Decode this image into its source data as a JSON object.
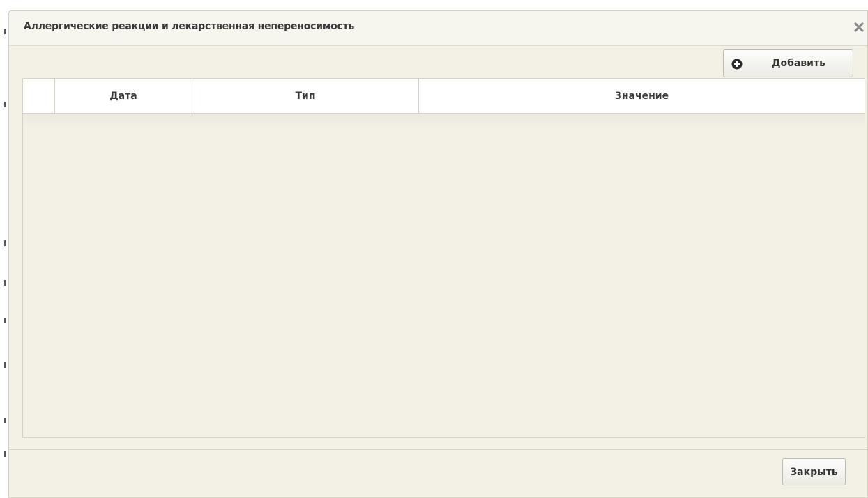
{
  "dialog": {
    "title": "Аллергические реакции и лекарственная непереносимость",
    "close_icon": "close-x-icon",
    "add_button": {
      "label": "Добавить",
      "icon": "plus-circle-icon"
    },
    "table": {
      "columns": [
        {
          "key": "select",
          "label": ""
        },
        {
          "key": "date",
          "label": "Дата"
        },
        {
          "key": "type",
          "label": "Тип"
        },
        {
          "key": "value",
          "label": "Значение"
        }
      ],
      "rows": []
    },
    "footer": {
      "close_label": "Закрыть"
    }
  },
  "colors": {
    "dialog_bg": "#f3f1e6",
    "header_bg": "#f7f6ee",
    "border": "#d6d3c5"
  }
}
